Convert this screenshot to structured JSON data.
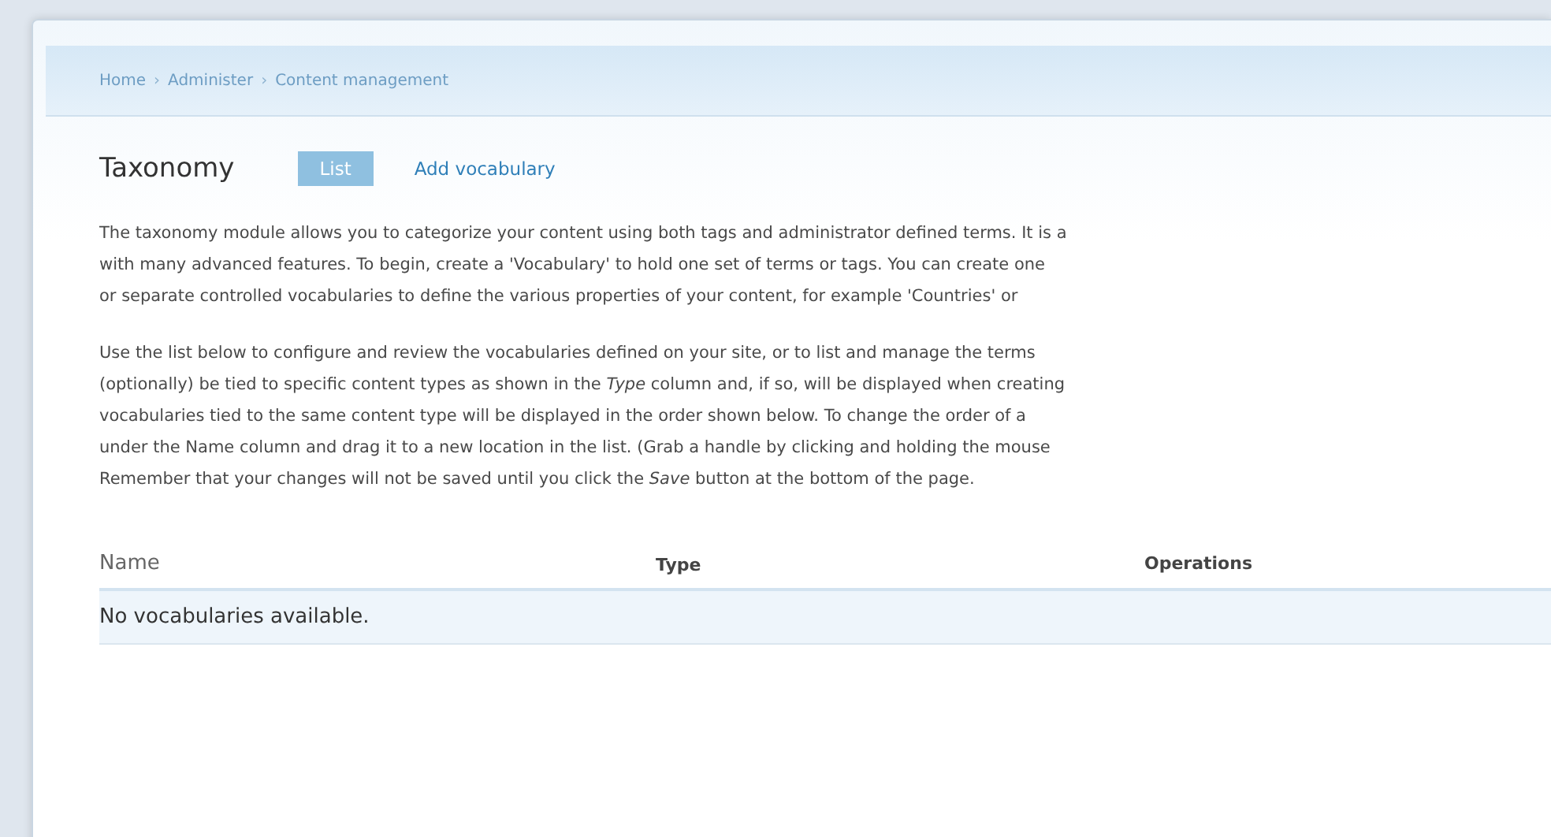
{
  "breadcrumb": [
    {
      "label": "Home"
    },
    {
      "label": "Administer"
    },
    {
      "label": "Content management"
    }
  ],
  "breadcrumb_separator": "›",
  "title": "Taxonomy",
  "tabs": [
    {
      "label": "List",
      "selected": true
    },
    {
      "label": "Add vocabulary",
      "selected": false
    }
  ],
  "paragraphs": [
    [
      "The taxonomy module allows you to categorize your content using both tags and administrator defined terms. It is a",
      "with many advanced features. To begin, create a 'Vocabulary' to hold one set of terms or tags. You can create one",
      "or separate controlled vocabularies to define the various properties of your content, for example 'Countries' or"
    ],
    [
      "Use the list below to configure and review the vocabularies defined on your site, or to list and manage the terms",
      "(optionally) be tied to specific content types as shown in the *Type* column and, if so, will be displayed when creating",
      "vocabularies tied to the same content type will be displayed in the order shown below. To change the order of a",
      "under the Name column and drag it to a new location in the list. (Grab a handle by clicking and holding the mouse",
      "Remember that your changes will not be saved until you click the *Save* button at the bottom of the page."
    ]
  ],
  "table": {
    "columns": [
      "Name",
      "Type",
      "Operations"
    ],
    "empty_message": "No vocabularies available."
  }
}
